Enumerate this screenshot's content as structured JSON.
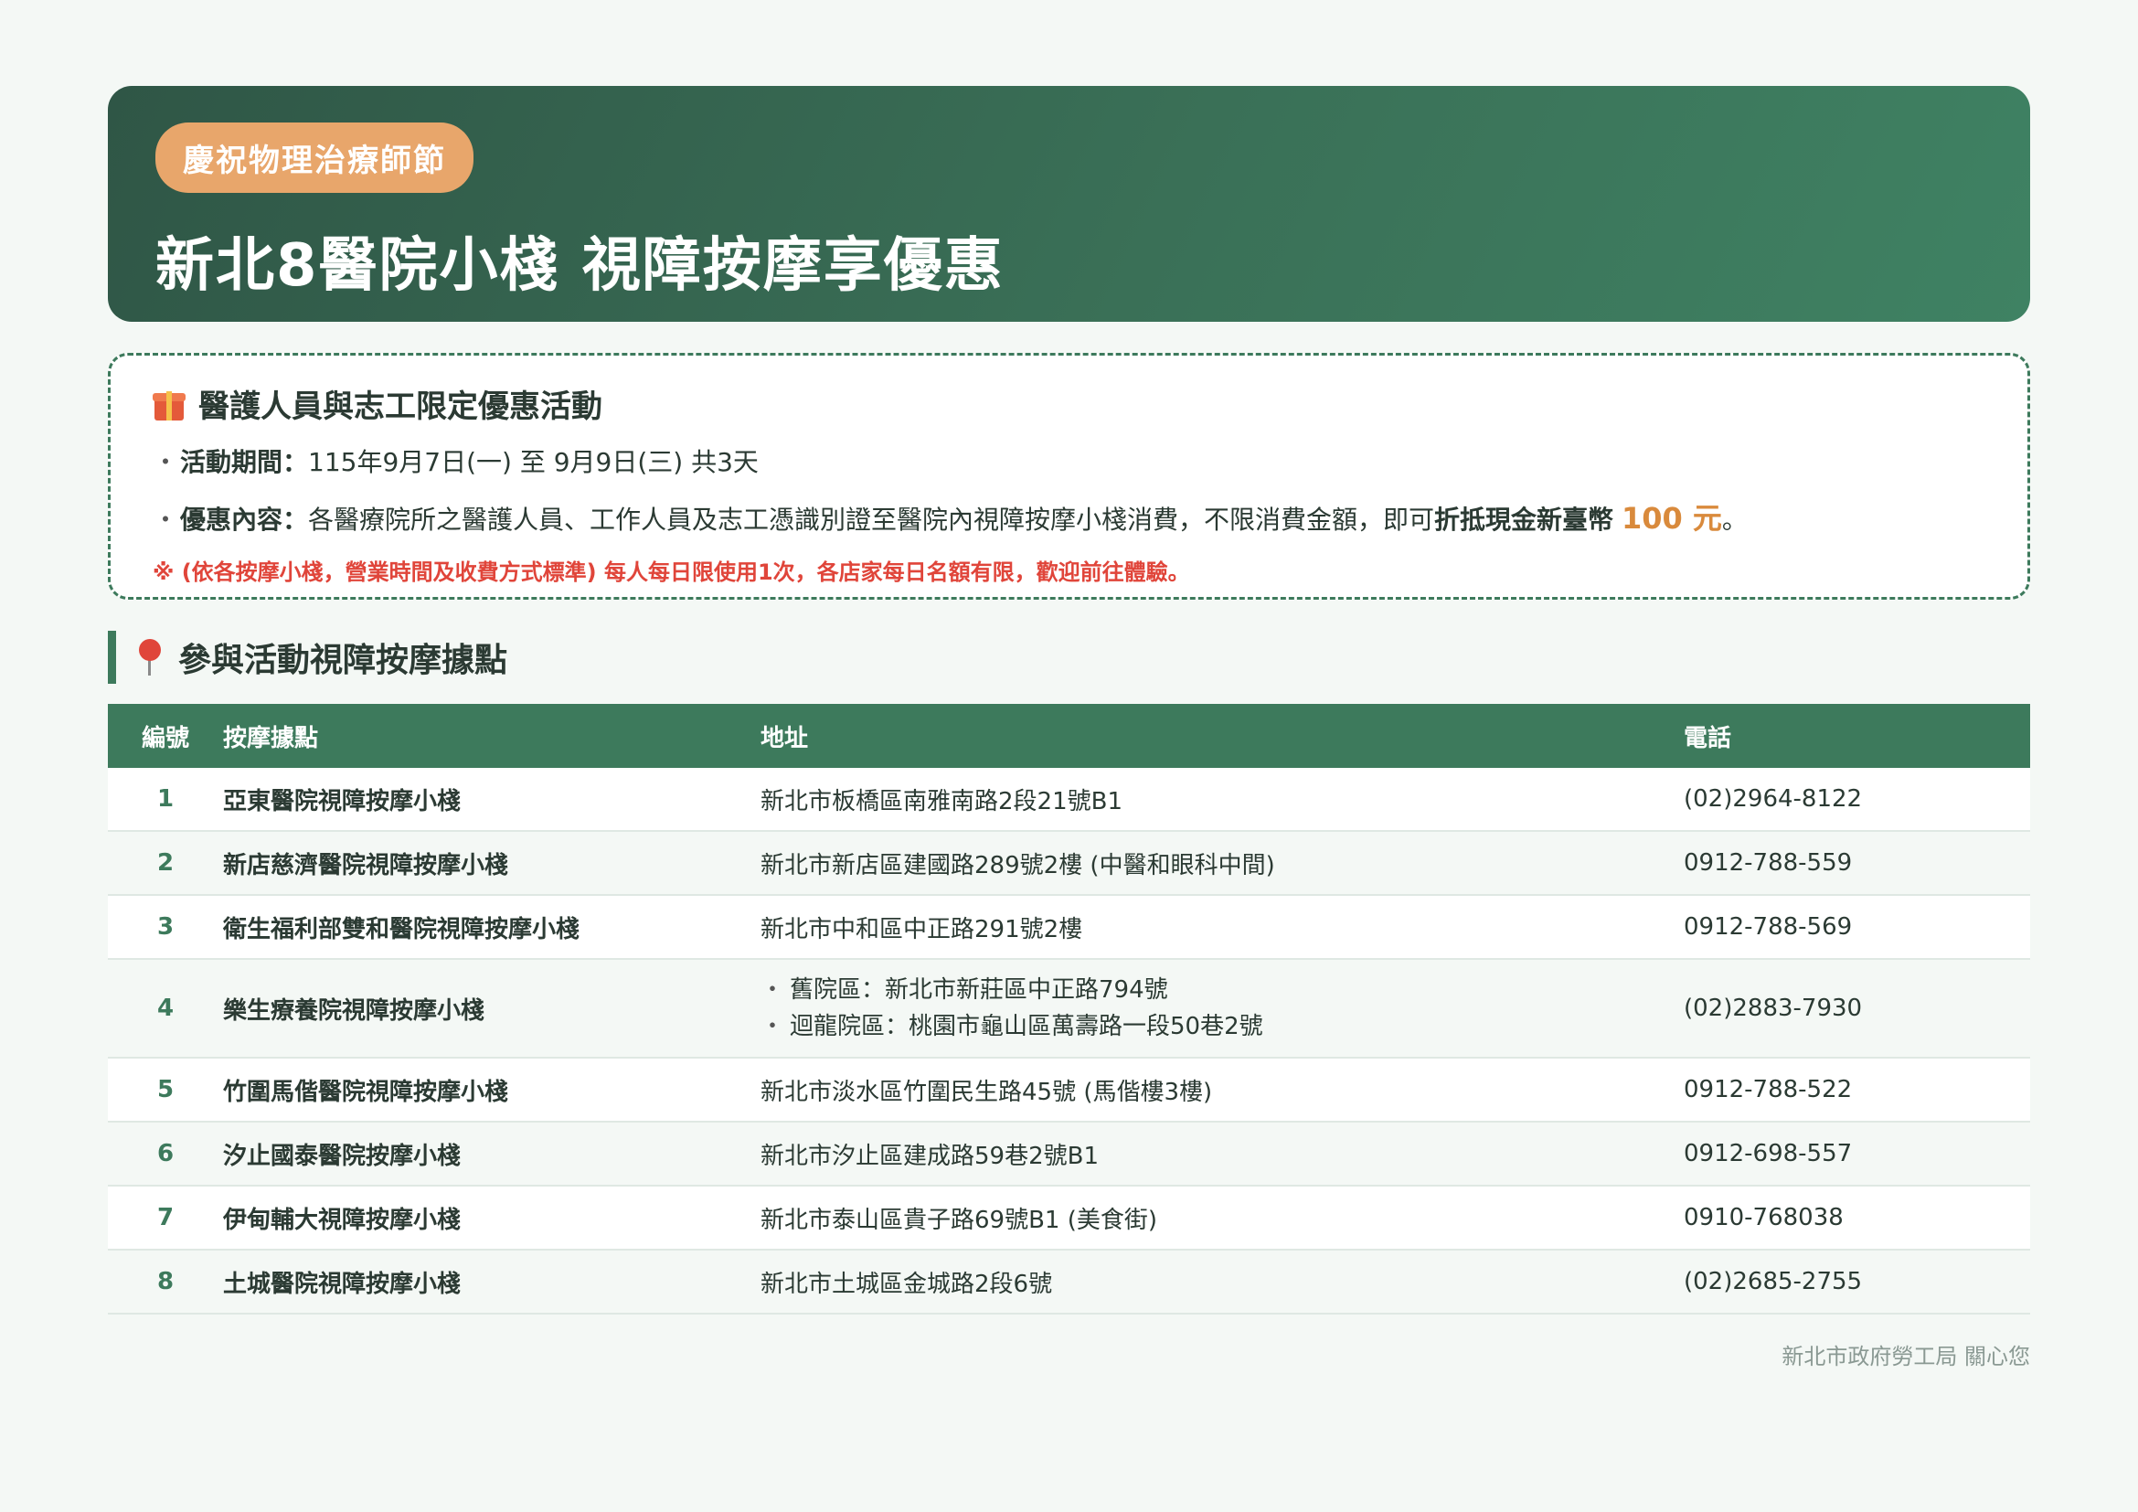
{
  "header": {
    "tag": "慶祝物理治療師節",
    "title": "新北8醫院小棧 視障按摩享優惠"
  },
  "promo": {
    "title": "醫護人員與志工限定優惠活動",
    "period_label": "活動期間：",
    "period_value": "115年9月7日(一) 至 9月9日(三) 共3天",
    "content_label": "優惠內容：",
    "content_text": "各醫療院所之醫護人員、工作人員及志工憑識別證至醫院內視障按摩小棧消費，不限消費金額，即可",
    "content_bold": "折抵現金新臺幣",
    "amount": "100 元",
    "content_end": "。",
    "note": "※ (依各按摩小棧，營業時間及收費方式標準) 每人每日限使用1次，各店家每日名額有限，歡迎前往體驗。",
    "bullet": "・"
  },
  "section_title": "參與活動視障按摩據點",
  "table": {
    "headers": [
      "編號",
      "按摩據點",
      "地址",
      "電話"
    ],
    "rows": [
      {
        "no": "1",
        "name": "亞東醫院視障按摩小棧",
        "addr": "新北市板橋區南雅南路2段21號B1",
        "phone": "(02)2964-8122"
      },
      {
        "no": "2",
        "name": "新店慈濟醫院視障按摩小棧",
        "addr": "新北市新店區建國路289號2樓 (中醫和眼科中間)",
        "phone": "0912-788-559"
      },
      {
        "no": "3",
        "name": "衛生福利部雙和醫院視障按摩小棧",
        "addr": "新北市中和區中正路291號2樓",
        "phone": "0912-788-569"
      },
      {
        "no": "4",
        "name": "樂生療養院視障按摩小棧",
        "addr_a": "舊院區：新北市新莊區中正路794號",
        "addr_b": "迴龍院區：桃園市龜山區萬壽路一段50巷2號",
        "phone": "(02)2883-7930"
      },
      {
        "no": "5",
        "name": "竹圍馬偕醫院視障按摩小棧",
        "addr": "新北市淡水區竹圍民生路45號 (馬偕樓3樓)",
        "phone": "0912-788-522"
      },
      {
        "no": "6",
        "name": "汐止國泰醫院按摩小棧",
        "addr": "新北市汐止區建成路59巷2號B1",
        "phone": "0912-698-557"
      },
      {
        "no": "7",
        "name": "伊甸輔大視障按摩小棧",
        "addr": "新北市泰山區貴子路69號B1 (美食街)",
        "phone": "0910-768038"
      },
      {
        "no": "8",
        "name": "土城醫院視障按摩小棧",
        "addr": "新北市土城區金城路2段6號",
        "phone": "(02)2685-2755"
      }
    ]
  },
  "footer": "新北市政府勞工局 關心您",
  "colors": {
    "primary": "#3d7a5c",
    "accent": "#e8a66b",
    "amount": "#d98a3c",
    "alert": "#e0453a"
  }
}
